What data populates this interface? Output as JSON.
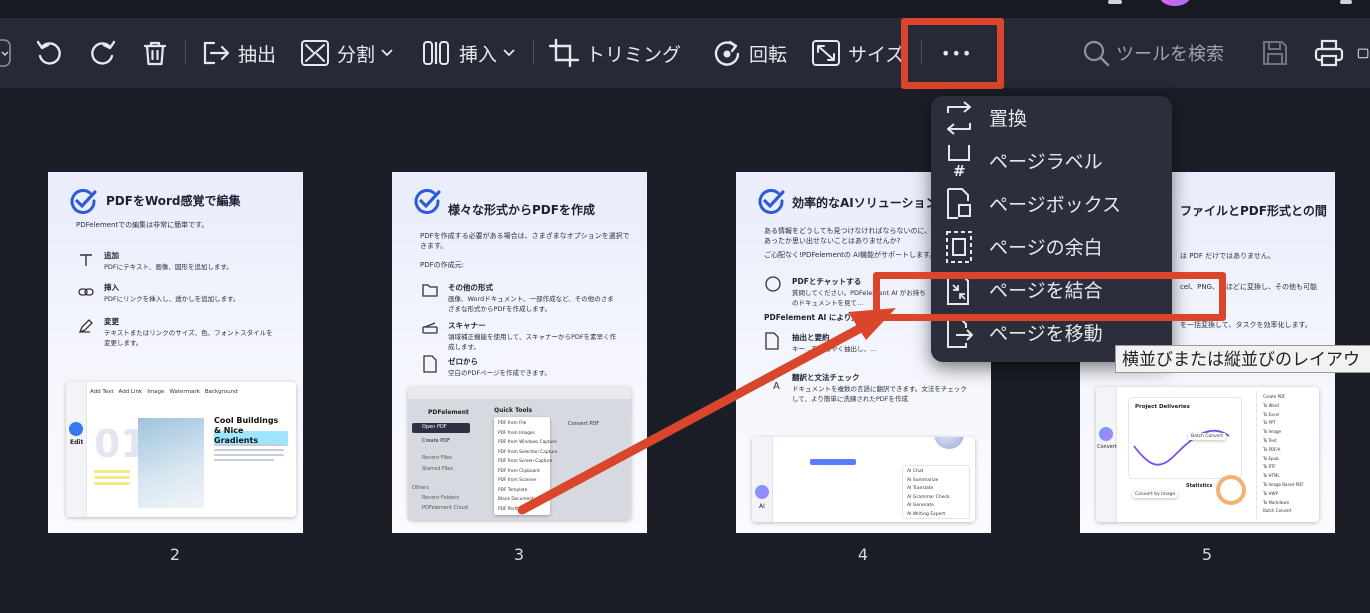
{
  "toolbar": {
    "extract": "抽出",
    "split": "分割",
    "insert": "挿入",
    "crop": "トリミング",
    "rotate": "回転",
    "size": "サイズ",
    "more": "•••",
    "search_placeholder": "ツールを検索"
  },
  "menu": {
    "items": [
      {
        "label": "置換",
        "icon": "replace-icon"
      },
      {
        "label": "ページラベル",
        "icon": "page-label-icon"
      },
      {
        "label": "ページボックス",
        "icon": "page-box-icon"
      },
      {
        "label": "ページの余白",
        "icon": "page-margin-icon"
      },
      {
        "label": "ページを結合",
        "icon": "merge-pages-icon"
      },
      {
        "label": "ページを移動",
        "icon": "move-page-icon"
      }
    ]
  },
  "tooltip": "横並びまたは縦並びのレイアウ",
  "pages": [
    {
      "number": "2",
      "title": "PDFをWord感覚で編集",
      "subtitle": "PDFelementでの編集は非常に簡単です。",
      "features": [
        {
          "head": "追加",
          "desc": "PDFにテキスト、画像、図形を追加します。"
        },
        {
          "head": "挿入",
          "desc": "PDFにリンクを挿入し、透かしを追加します。"
        },
        {
          "head": "変更",
          "desc": "テキストまたはリンクのサイズ、色、フォントスタイルを変更します。"
        }
      ],
      "shot_tools": [
        "Add Text",
        "Add Link",
        "Image",
        "Watermark",
        "Background"
      ],
      "shot_label": "Edit",
      "shot_heading": "Cool Buildings & Nice Gradients",
      "shot_big": "01"
    },
    {
      "number": "3",
      "title": "様々な形式からPDFを作成",
      "subtitle": "PDFを作成する必要がある場合は、さまざまなオプションを選択できます。",
      "section": "PDFの作成元:",
      "features": [
        {
          "head": "その他の形式",
          "desc": "画像、Wordドキュメント、一部作成など、その他のさまざまな形式からPDFを作成します。"
        },
        {
          "head": "スキャナー",
          "desc": "領域補正機能を使用して、スキャナーからPDFを素早く作成します。"
        },
        {
          "head": "ゼロから",
          "desc": "空白のPDFページを作成できます。"
        }
      ],
      "shot_app": "PDFelement",
      "shot_menu": [
        "Open PDF",
        "Create PDF",
        "Recent Files",
        "Starred Files",
        "Others",
        "Recent Folders",
        "PDFelement Cloud"
      ],
      "shot_quick": "Quick Tools",
      "shot_list": [
        "PDF from File",
        "PDF from Images",
        "PDF from Windows Capture",
        "PDF from Selection Capture",
        "PDF from Screen Capture",
        "PDF from Clipboard",
        "PDF from Scanner",
        "PDF Template",
        "Blank Document",
        "PDF Portfolio"
      ],
      "shot_convert": "Convert PDF"
    },
    {
      "number": "4",
      "title": "効率的なAIソリューション",
      "subtitle": "ある情報をどうしても見つけなければならないのに、どのにあったか思い出せないことはありませんか?",
      "subtitle2": "ご心配なく!PDFelementの AI機能がサポートします。",
      "features": [
        {
          "head": "PDFとチャットする",
          "desc": "質問してください。PDFelement AI がお持ちのドキュメントを見て…"
        },
        {
          "head": "PDFelement AI により効率が大幅に",
          "desc": ""
        },
        {
          "head": "抽出と要約",
          "desc": "キー…をすばやく抽出し、…"
        },
        {
          "head": "翻訳と文法チェック",
          "desc": "ドキュメントを複数の言語に翻訳できます。文法をチェックして、より簡単に洗練されたPDFを作成"
        }
      ],
      "shot_label": "AI",
      "shot_items": [
        "AI Chat",
        "AI Summarize",
        "AI Translate",
        "AI Grammar Check",
        "AI Generate",
        "AI Writing Expert"
      ]
    },
    {
      "number": "5",
      "title": "ファイルとPDF形式との間",
      "subtitle": "は PDF だけではありません。",
      "lines": [
        "cel、PNG、…ほどに変換し、その他も可能",
        "を一括変換して、タスクを効率化します。"
      ],
      "shot_label": "Convert",
      "shot_chart": "Project Deliveries",
      "shot_stat": "Statistics",
      "shot_list": [
        "Create PDF",
        "To Word",
        "To Excel",
        "To PPT",
        "To Image",
        "To Text",
        "To PDF/A",
        "To Epub",
        "To RTF",
        "To HTML",
        "To Image Based PDF",
        "To HWP",
        "To Markdown",
        "Batch Convert"
      ],
      "shot_badge": "Batch Convert",
      "shot_button": "Convert by Image"
    }
  ],
  "colors": {
    "background": "#1b1e27",
    "toolbar": "#262a36",
    "highlight": "#d9462c",
    "menu": "#2c2f3b",
    "accent": "#2b5cdb"
  }
}
